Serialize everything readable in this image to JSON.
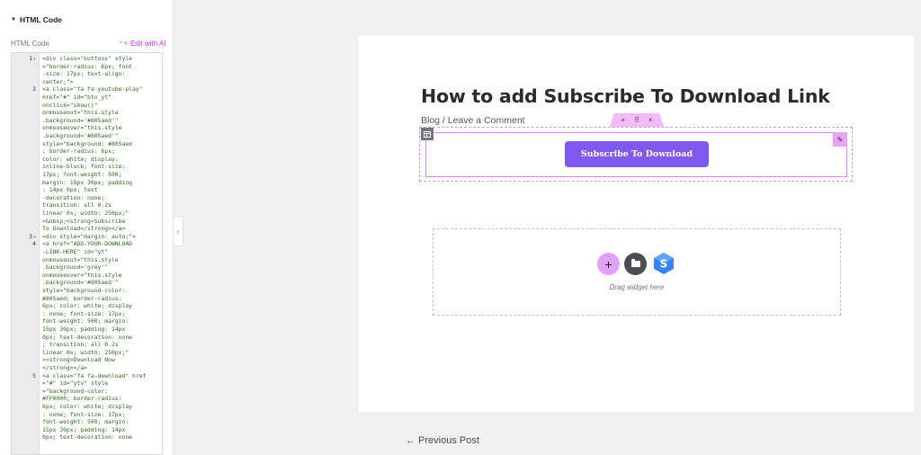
{
  "panel": {
    "title": "HTML Code",
    "field_label": "HTML Code",
    "edit_ai": "Edit with AI",
    "code_lines": [
      {
        "num": "1",
        "fold": true,
        "lines": [
          "<div class=\"buttons\" style",
          "=\"border-radius: 6px; font",
          "-size: 17px; text-align:",
          "center;\">"
        ]
      },
      {
        "num": "2",
        "fold": false,
        "lines": [
          "<a class=\"fa fa-youtube-play\"",
          "href=\"#\" id=\"btn_yt\"",
          "onclick=\"show()\"",
          "onmouseout=\"this.style",
          ".background='#805aed'\"",
          "onmouseover=\"this.style",
          ".background='#805aed'\"",
          "style=\"background: #805aed",
          "; border-radius: 6px;",
          "color: white; display:",
          "inline-block; font-size:",
          "17px; font-weight: 500;",
          "margin: 15px 30px; padding",
          ": 14px 0px; text",
          "-decoration: none;",
          "transition: all 0.2s",
          "linear 0s; width: 250px;\"",
          ">&nbsp;<strong>Subscribe",
          "To Download</strong></a>"
        ]
      },
      {
        "num": "3",
        "fold": true,
        "lines": [
          "<div style=\"margin: auto;\">"
        ]
      },
      {
        "num": "4",
        "fold": false,
        "lines": [
          "<a href=\"ADD-YOUR-DOWNLOAD",
          "-LINK-HERE\" id=\"yt\"",
          "onmouseout=\"this.style",
          ".background='grey'\"",
          "onmouseover=\"this.style",
          ".background='#805aed'\"",
          "style=\"background-color:",
          "#805aed; border-radius:",
          "6px; color: white; display",
          ": none; font-size: 17px;",
          "font-weight: 500; margin:",
          "15px 30px; padding: 14px",
          "0px; text-decoration: none",
          "; transition: all 0.2s",
          "linear 0s; width: 250px;\"",
          "><strong>Download Now",
          "</strong></a>"
        ]
      },
      {
        "num": "5",
        "fold": false,
        "lines": [
          "<a class=\"fa fa-download\" href",
          "=\"#\" id=\"ytv\" style",
          "=\"background-color:",
          "#FF0000; border-radius:",
          "6px; color: white; display",
          ": none; font-size: 17px;",
          "font-weight: 500; margin:",
          "15px 30px; padding: 14px",
          "0px; text-decoration: none"
        ]
      }
    ]
  },
  "canvas": {
    "post_title": "How to add Subscribe To Download Link",
    "meta_category": "Blog",
    "meta_separator": " / ",
    "meta_comment": "Leave a Comment",
    "section_handle": {
      "add": "+",
      "move": "⠿",
      "close": "×"
    },
    "subscribe_button": "Subscribe To Download",
    "drop_zone_text": "Drag widget here",
    "add_symbol": "+",
    "prev_post": "← Previous Post"
  },
  "colors": {
    "accent": "#805aed",
    "editor_pink": "#e57fff",
    "ai_magenta": "#c336e5"
  },
  "icons": {
    "collapse": "chevron-left-icon",
    "widget_edit": "pencil-icon",
    "column": "column-icon",
    "folder": "folder-icon",
    "starter": "starter-templates-icon"
  }
}
